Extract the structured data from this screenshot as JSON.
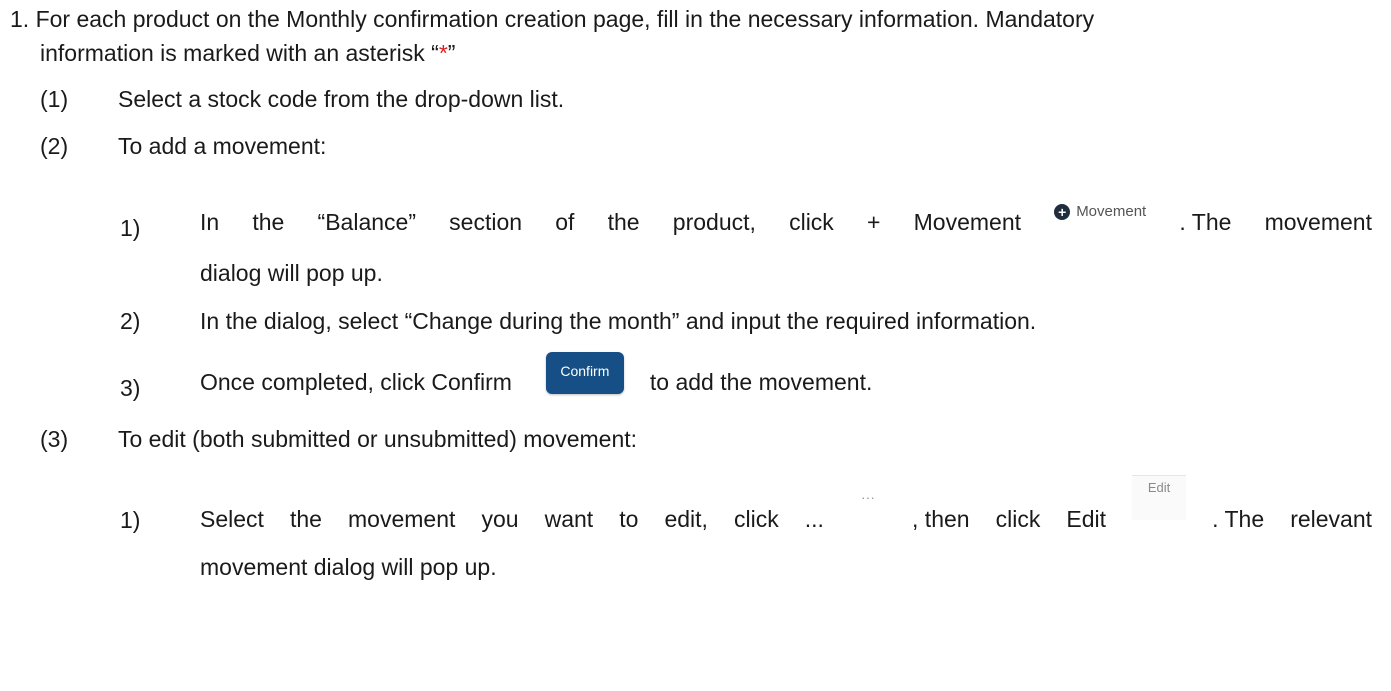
{
  "intro": {
    "number": "1.",
    "line1": "For each product on the Monthly confirmation creation page, fill in the necessary information. Mandatory",
    "line2_pre": "information is marked with an asterisk “",
    "asterisk": "*",
    "line2_post": "”"
  },
  "steps": {
    "s1": {
      "num": "(1)",
      "text": "Select a stock code from the drop-down list."
    },
    "s2": {
      "num": "(2)",
      "text": "To add a movement:"
    },
    "s2_1": {
      "num": "1)",
      "w1": "In",
      "w2": "the",
      "w3": "“Balance”",
      "w4": "section",
      "w5": "of",
      "w6": "the",
      "w7": "product,",
      "w8": "click",
      "w9": "+",
      "w10": "Movement",
      "tail_a": ". The",
      "tail_b": "movement",
      "line2": "dialog will pop up."
    },
    "s2_2": {
      "num": "2)",
      "text": "In the dialog, select “Change during the month” and input the required information."
    },
    "s2_3": {
      "num": "3)",
      "text_pre": "Once completed, click Confirm",
      "text_post": "to add the movement."
    },
    "s3": {
      "num": "(3)",
      "text": "To edit (both submitted or unsubmitted) movement:"
    },
    "s3_1": {
      "num": "1)",
      "w1": "Select",
      "w2": "the",
      "w3": "movement",
      "w4": "you",
      "w5": "want",
      "w6": "to",
      "w7": "edit,",
      "w8": "click",
      "w9": "...",
      "mid_a": ", then",
      "mid_b": "click",
      "mid_c": "Edit",
      "tail_a": ". The",
      "tail_b": "relevant",
      "line2": "movement dialog will pop up."
    }
  },
  "ui_snippets": {
    "movement_button_label": "Movement",
    "movement_button_icon": "plus-circle-icon",
    "confirm_button_label": "Confirm",
    "more_icon_glyph": "···",
    "edit_label": "Edit",
    "confirm_color": "#154f86"
  }
}
